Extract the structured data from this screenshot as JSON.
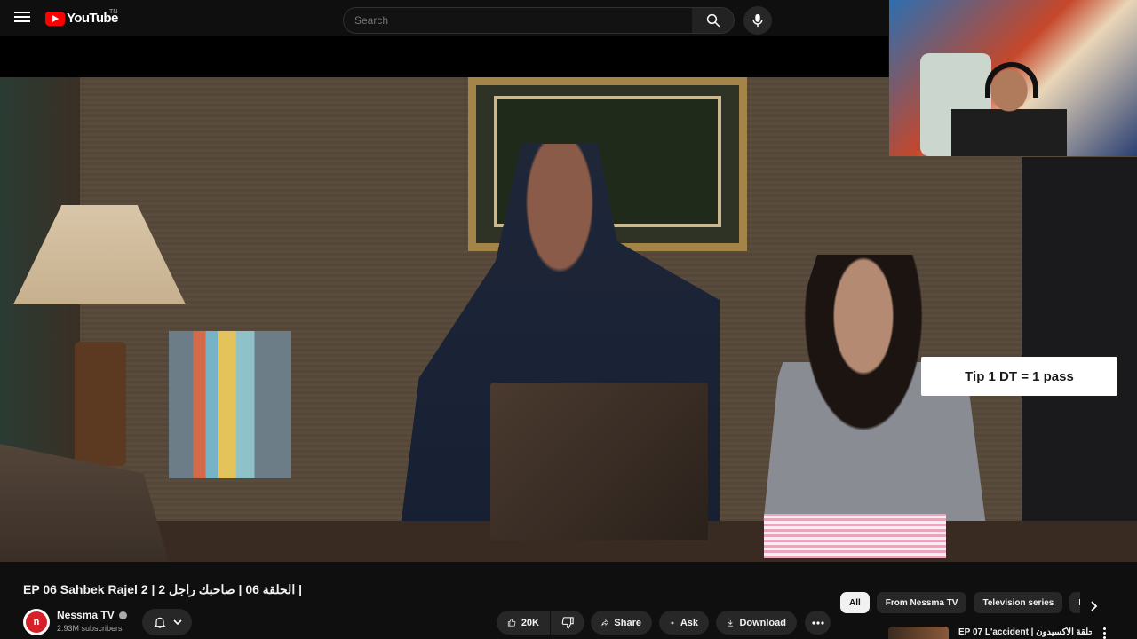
{
  "header": {
    "logo_text": "YouTube",
    "logo_tm": "TN",
    "search_placeholder": "Search"
  },
  "overlay": {
    "tip_text": "Tip 1 DT = 1 pass"
  },
  "video": {
    "title": "EP 06 Sahbek Rajel 2 | الحلقة 06 | صاحبك راجل 2 |",
    "channel_name": "Nessma TV",
    "channel_avatar_text": "n",
    "subscribers": "2.93M subscribers",
    "likes": "20K",
    "share_label": "Share",
    "ask_label": "Ask",
    "download_label": "Download"
  },
  "chips": [
    {
      "label": "All",
      "active": true
    },
    {
      "label": "From Nessma TV",
      "active": false
    },
    {
      "label": "Television series",
      "active": false
    },
    {
      "label": "Re",
      "active": false
    }
  ],
  "recommendation": {
    "title": "EP 07 L'accident | الحلقة الأكسيدون"
  },
  "colors": {
    "background": "#0f0f0f",
    "pill": "#272727",
    "brand_red": "#ff0000",
    "channel_red": "#d6202a"
  }
}
